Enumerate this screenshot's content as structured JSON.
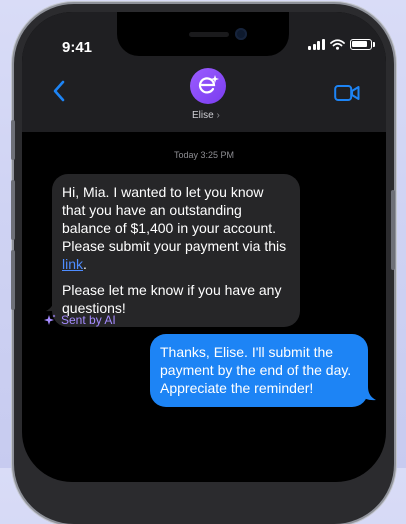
{
  "status_bar": {
    "time": "9:41"
  },
  "header": {
    "contact_name": "Elise",
    "avatar_icon": "e-sparkle-icon"
  },
  "conversation": {
    "timestamp": "Today 3:25 PM",
    "incoming": {
      "para1_text": "Hi, Mia. I wanted to let you know that you have an outstanding balance of $1,400 in your account. Please submit your payment via this ",
      "link_text": "link",
      "para1_end": ".",
      "para2_text": "Please let me know if you have any questions!"
    },
    "sent_by_ai_label": "Sent by AI",
    "outgoing": {
      "text": "Thanks, Elise. I'll submit the payment by the end of the day. Appreciate the reminder!"
    }
  },
  "colors": {
    "incoming_bubble": "#262628",
    "outgoing_bubble": "#1d84f5",
    "accent": "#1d84f5",
    "ai_label": "#a58bff",
    "avatar": "#8b4dff"
  }
}
